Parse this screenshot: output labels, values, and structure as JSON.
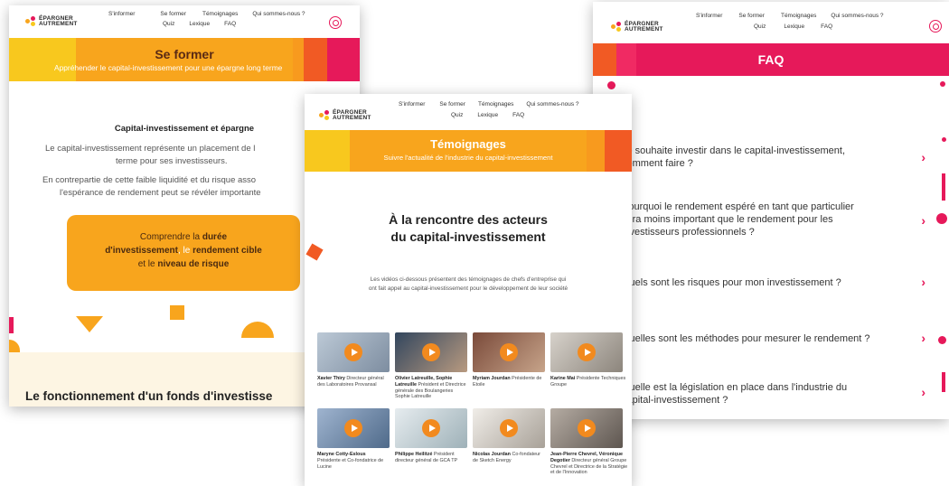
{
  "brand": {
    "line1": "ÉPARGNER",
    "line2": "AUTREMENT",
    "colors": [
      "#f8a51d",
      "#e6195a",
      "#f7c81e",
      "#f15a24"
    ]
  },
  "nav": {
    "sinformer": "S'informer",
    "seformer": "Se former",
    "temoignages": "Témoignages",
    "quisommes": "Qui sommes-nous ?",
    "quiz": "Quiz",
    "lexique": "Lexique",
    "faq": "FAQ"
  },
  "icons": {
    "search": "search-icon",
    "play": "play-icon",
    "chevron": "chevron-right-icon"
  },
  "left": {
    "hero_title": "Se former",
    "hero_subtitle": "Appréhender le capital-investissement pour une épargne long terme",
    "section_title": "Capital-investissement et épargne",
    "para1a": "Le capital-investissement représente un placement de l",
    "para1b": "terme pour ses investisseurs.",
    "para2a": "En contrepartie de cette faible liquidité et du risque asso",
    "para2b": "l'espérance de rendement peut se révéler importante",
    "cta": {
      "pre": "Comprendre la ",
      "b1": "durée",
      "mid1": "d'investissement",
      "sep": ", le ",
      "b2": "rendement cible",
      "mid2": "et le ",
      "b3": "niveau de risque"
    },
    "footer_title": "Le fonctionnement d'un fonds d'investisse"
  },
  "middle": {
    "hero_title": "Témoignages",
    "hero_subtitle": "Suivre l'actualité de l'industrie du capital-investissement",
    "heading1": "À la rencontre des acteurs",
    "heading2": "du capital-investissement",
    "intro1": "Les vidéos ci-dessous présentent des témoignages de chefs d'entreprise qui",
    "intro2": "ont fait appel au capital-investissement pour le développement de leur société",
    "videos": [
      {
        "name": "Xavier Thiry",
        "desc": "Directeur général des Laboratoires Provansal"
      },
      {
        "name": "Olivier Latreuille, Sophie Latreuille",
        "desc": "Président et Directrice générale des Boulangeries Sophie Latreuille"
      },
      {
        "name": "Myriam Jourdan",
        "desc": "Présidente de Etoile"
      },
      {
        "name": "Karine Mai",
        "desc": "Présidente Techniques Groupe"
      },
      {
        "name": "Maryne Cotty-Eslous",
        "desc": "Présidente et Co-fondatrice de Lucine"
      },
      {
        "name": "Philippe Heilitzé",
        "desc": "Président directeur général de GCA TP"
      },
      {
        "name": "Nicolas Jourdan",
        "desc": "Co-fondateur de Sketch Energy"
      },
      {
        "name": "Jean-Pierre Chevrel, Véronique Degotier",
        "desc": "Directeur général Groupe Chevrel et Directrice de la Stratégie et de l'Innovation"
      }
    ]
  },
  "right": {
    "hero_title": "FAQ",
    "questions": [
      {
        "l1": "Je souhaite investir dans le capital-investissement,",
        "l2": "comment faire ?",
        "l3": ""
      },
      {
        "l1": "Pourquoi le rendement espéré en tant que particulier",
        "l2": "sera moins important que le rendement pour les",
        "l3": "investisseurs professionnels ?"
      },
      {
        "l1": "Quels sont les risques pour mon investissement ?",
        "l2": "",
        "l3": ""
      },
      {
        "l1": "Quelles sont les méthodes pour mesurer le rendement ?",
        "l2": "",
        "l3": ""
      },
      {
        "l1": "Quelle est la législation en place dans l'industrie du",
        "l2": "capital-investissement ?",
        "l3": ""
      }
    ],
    "chevron": "›"
  }
}
